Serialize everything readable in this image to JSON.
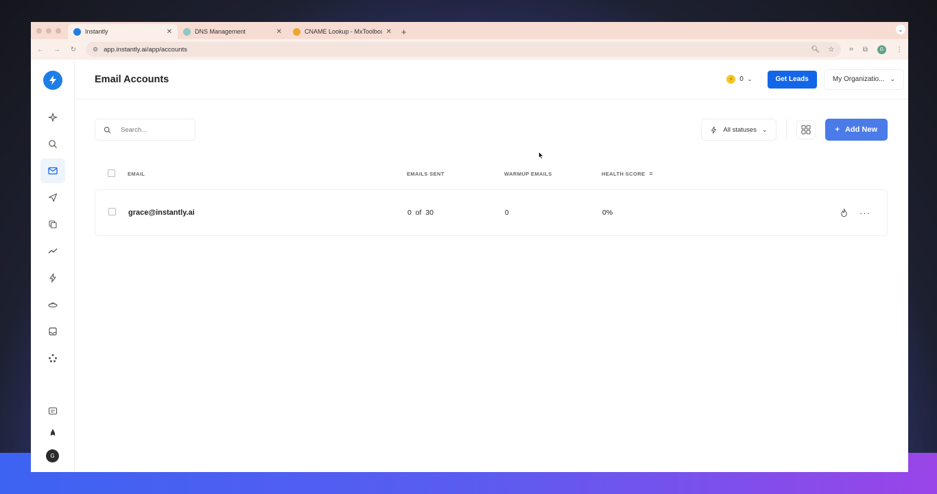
{
  "browser": {
    "tabs": [
      {
        "title": "Instantly",
        "favicon_color": "#1e7ee6",
        "active": true
      },
      {
        "title": "DNS Management",
        "favicon_color": "#8fc7c4",
        "active": false
      },
      {
        "title": "CNAME Lookup - MxToolbox",
        "favicon_color": "#f0a52c",
        "active": false
      }
    ],
    "url": "app.instantly.ai/app/accounts",
    "profile_initial": "G"
  },
  "sidebar": {
    "items": [
      {
        "name": "sparkle-icon",
        "active": false
      },
      {
        "name": "search-icon",
        "active": false
      },
      {
        "name": "mail-icon",
        "active": true
      },
      {
        "name": "send-icon",
        "active": false
      },
      {
        "name": "copy-icon",
        "active": false
      },
      {
        "name": "analytics-icon",
        "active": false
      },
      {
        "name": "bolt-icon",
        "active": false
      },
      {
        "name": "ufo-icon",
        "active": false
      },
      {
        "name": "inbox-icon",
        "active": false
      },
      {
        "name": "network-icon",
        "active": false
      }
    ],
    "avatar_initial": "G"
  },
  "header": {
    "title": "Email Accounts",
    "credits": "0",
    "get_leads_label": "Get Leads",
    "org_label": "My Organizatio..."
  },
  "toolbar": {
    "search_placeholder": "Search...",
    "status_filter_label": "All statuses",
    "add_new_label": "Add New"
  },
  "table": {
    "columns": [
      "EMAIL",
      "EMAILS SENT",
      "WARMUP EMAILS",
      "HEALTH SCORE"
    ],
    "rows": [
      {
        "email": "grace@instantly.ai",
        "emails_sent": "0  of  30",
        "warmup_emails": "0",
        "health_score": "0%"
      }
    ]
  },
  "colors": {
    "brand": "#1e7ee6",
    "primary_button": "#1466e8",
    "add_button": "#4a7be8"
  }
}
